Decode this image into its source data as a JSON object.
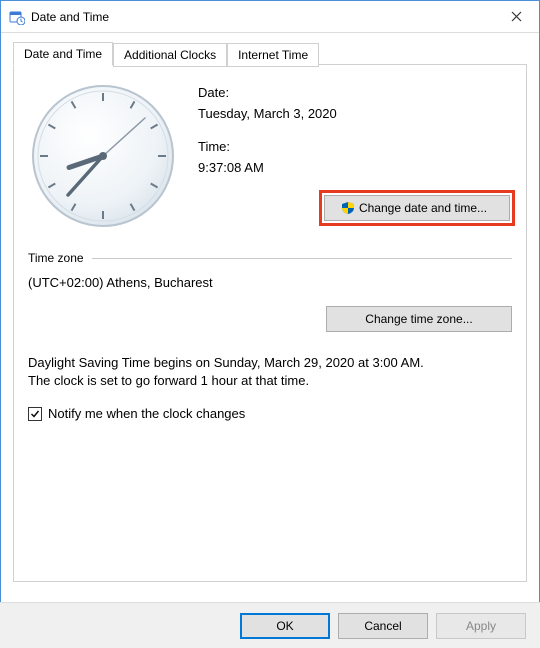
{
  "window": {
    "title": "Date and Time"
  },
  "tabs": {
    "t1": "Date and Time",
    "t2": "Additional Clocks",
    "t3": "Internet Time"
  },
  "date": {
    "label": "Date:",
    "value": "Tuesday, March 3, 2020"
  },
  "time": {
    "label": "Time:",
    "value": "9:37:08 AM"
  },
  "buttons": {
    "change_dt": "Change date and time...",
    "change_tz": "Change time zone...",
    "ok": "OK",
    "cancel": "Cancel",
    "apply": "Apply"
  },
  "tz": {
    "header": "Time zone",
    "value": "(UTC+02:00) Athens, Bucharest"
  },
  "dst": {
    "line1": "Daylight Saving Time begins on Sunday, March 29, 2020 at 3:00 AM.",
    "line2": "The clock is set to go forward 1 hour at that time."
  },
  "notify": {
    "label": "Notify me when the clock changes",
    "checked": true
  },
  "clock": {
    "hour": 9,
    "minute": 37,
    "second": 8
  }
}
